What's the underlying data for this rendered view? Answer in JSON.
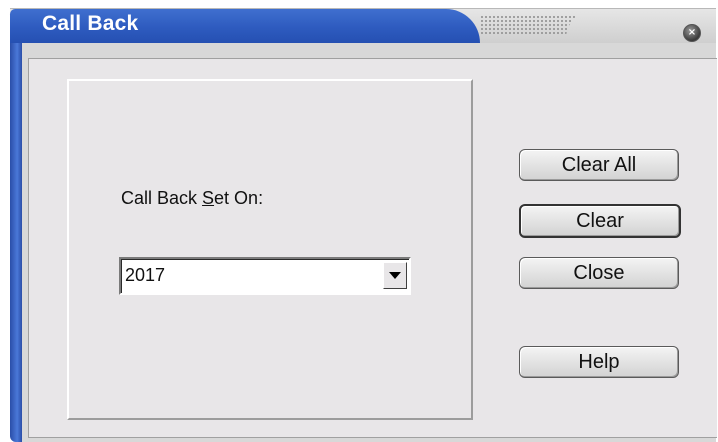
{
  "window": {
    "title": "Call Back",
    "close_glyph": "×"
  },
  "form": {
    "label_prefix": "Call Back ",
    "label_mnemonic": "S",
    "label_suffix": "et On:",
    "combo_value": "2017"
  },
  "buttons": {
    "clear_all": "Clear All",
    "clear": "Clear",
    "close": "Close",
    "help": "Help"
  },
  "colors": {
    "title_bar": "#2e5bbf",
    "client_bg": "#e8e6e8"
  }
}
